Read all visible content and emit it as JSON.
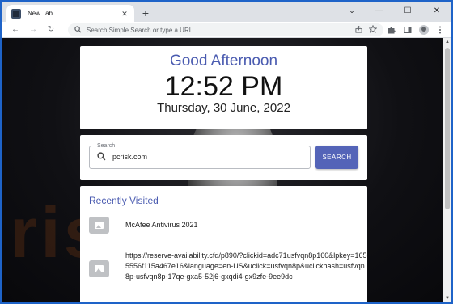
{
  "browser": {
    "tab_title": "New Tab",
    "tab_close": "✕",
    "new_tab": "+",
    "window_controls": {
      "chevron": "⌄",
      "minimize": "—",
      "maximize": "☐",
      "close": "✕"
    },
    "toolbar": {
      "back": "←",
      "forward": "→",
      "reload": "↻",
      "omnibox_placeholder": "Search Simple Search or type a URL",
      "omnibox_icon": "search-icon",
      "share_icon": "share-icon",
      "bookmark_icon": "star-icon",
      "extensions_icon": "puzzle-icon",
      "sidepanel_icon": "sidepanel-icon",
      "menu_icon": "kebab-menu-icon"
    }
  },
  "page": {
    "greeting": "Good Afternoon",
    "time": "12:52 PM",
    "date": "Thursday, 30 June, 2022",
    "search": {
      "legend": "Search",
      "value": "pcrisk.com",
      "button_label": "SEARCH"
    },
    "recent": {
      "title": "Recently Visited",
      "items": [
        {
          "label": "McAfee Antivirus 2021"
        },
        {
          "label": "https://reserve-availability.cfd/p890/?clickid=adc71usfvqn8p160&lpkey=1655556f115a467e16&language=en-US&uclick=usfvqn8p&uclickhash=usfvqn8p-usfvqn8p-17qe-gxa5-52j6-gxqdi4-gx9zfe-9ee9dc"
        }
      ]
    },
    "background_watermark": "risk.com"
  },
  "colors": {
    "accent": "#4a5bb0",
    "button": "#5464b8",
    "window_border": "#1e63c8",
    "watermark": "#cd5f14"
  }
}
